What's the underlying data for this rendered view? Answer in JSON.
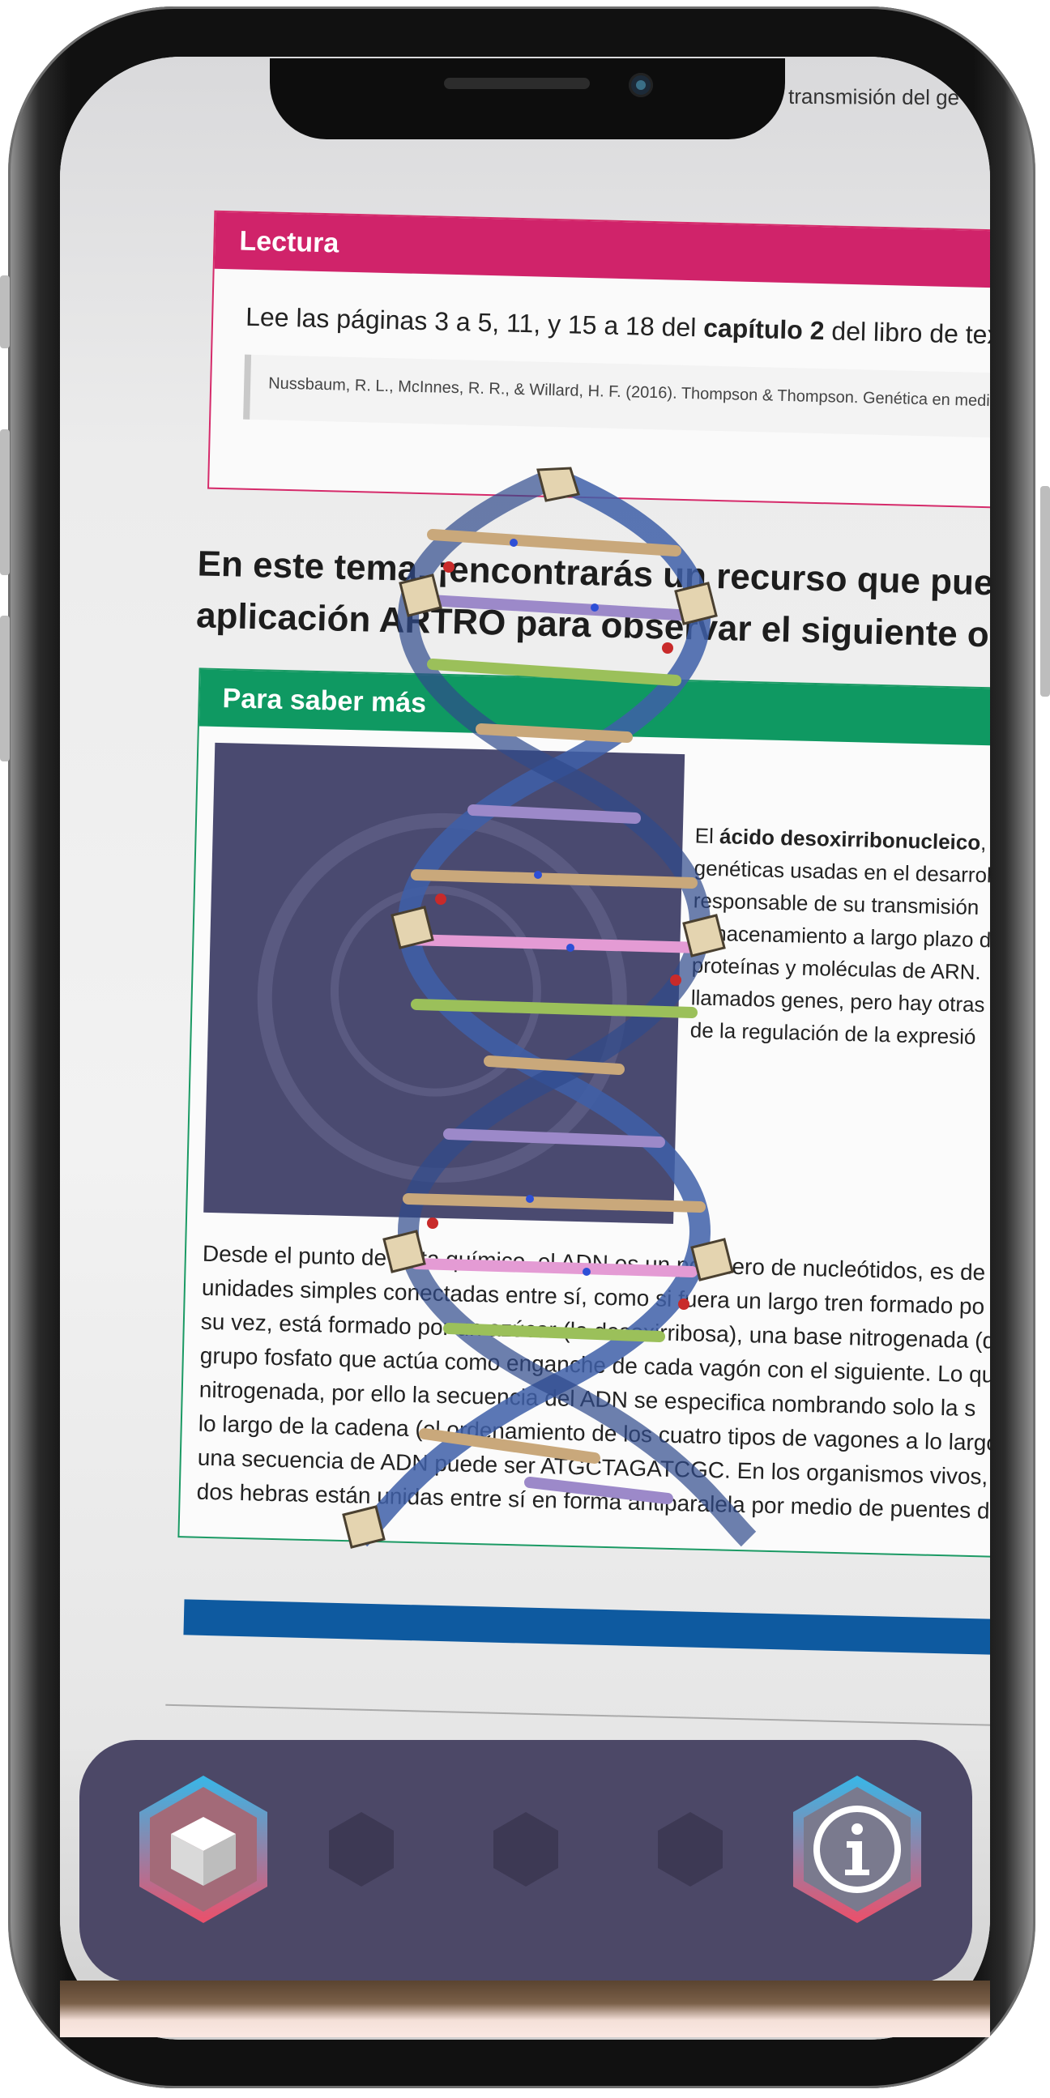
{
  "camera_view": {
    "top_snippet": "transmisión del ge",
    "lectura": {
      "header": "Lectura",
      "line1_prefix": "Lee las páginas 3 a 5, 11, y 15 a 18 del ",
      "line1_bold": "capítulo 2",
      "line1_suffix": " del libro de texto.",
      "citation": "Nussbaum, R. L., McInnes, R. R., & Willard, H. F. (2016). Thompson & Thompson. Genética en medicina. Barcelo"
    },
    "heading": {
      "line1": "En este tema, ¡encontrarás un recurso que puedes v",
      "line2": "aplicación ARTRO para observar el siguiente objeto"
    },
    "saber_mas": {
      "header": "Para saber más",
      "desc_lines": [
        {
          "prefix": "El ",
          "bold": "ácido desoxirribonucleico",
          "suffix": ", a"
        },
        {
          "prefix": "genéticas usadas en el desarrol",
          "bold": "",
          "suffix": ""
        },
        {
          "prefix": "responsable de su transmisión ",
          "bold": "",
          "suffix": ""
        },
        {
          "prefix": "almacenamiento a largo plazo d",
          "bold": "",
          "suffix": ""
        },
        {
          "prefix": "proteínas y moléculas de ARN.",
          "bold": "",
          "suffix": ""
        },
        {
          "prefix": "llamados genes, pero hay otras",
          "bold": "",
          "suffix": ""
        },
        {
          "prefix": "de la regulación  de la  expresió",
          "bold": "",
          "suffix": ""
        }
      ],
      "body_lines": [
        "Desde el punto de vista químico, el ADN es un polímero de nucleótidos, es de",
        "unidades simples conectadas entre sí, como si fuera un largo tren formado po",
        "su vez, está formado por un azúcar (la desoxirribosa), una base nitrogenada (qu",
        "grupo fosfato que actúa como enganche de cada vagón con el siguiente. Lo qu",
        "nitrogenada, por ello la secuencia del ADN se especifica nombrando solo la s",
        "lo largo de la cadena (el ordenamiento de los cuatro tipos de vagones a lo largo",
        "una secuencia de ADN puede ser ATGCTAGATCGC. En los organismos vivos, e",
        "dos hebras están unidas entre sí en forma antiparalela por medio de puentes d"
      ]
    }
  },
  "toolbar": {
    "buttons": [
      {
        "name": "3d-object",
        "icon": "cube-icon",
        "state": "active"
      },
      {
        "name": "slot-2",
        "icon": "hexagon-icon",
        "state": "empty"
      },
      {
        "name": "slot-3",
        "icon": "hexagon-icon",
        "state": "empty"
      },
      {
        "name": "slot-4",
        "icon": "hexagon-icon",
        "state": "empty"
      },
      {
        "name": "info",
        "icon": "info-icon",
        "state": "active"
      }
    ]
  },
  "colors": {
    "toolbar_bg": "#4c4867",
    "hex_gradient_top": "#37b7e8",
    "hex_gradient_bottom": "#ec4f6a",
    "lectura_accent": "#d0236a",
    "saber_accent": "#0f9962"
  }
}
